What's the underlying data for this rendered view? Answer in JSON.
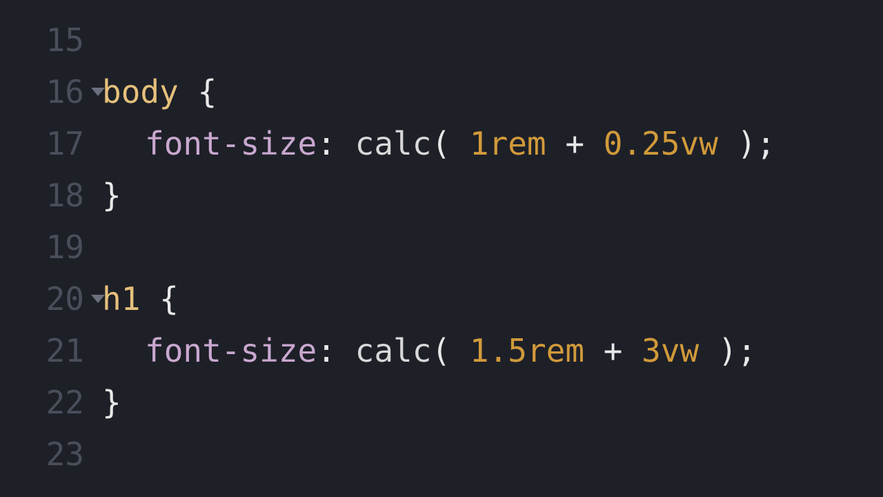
{
  "colors": {
    "background": "#1e2028",
    "line_number": "#4a4e5a",
    "selector": "#e6c07b",
    "property": "#c9a8cf",
    "number": "#d19a3a",
    "punctuation": "#e8e8e8",
    "fold_arrow": "#6b6f7d"
  },
  "lines": {
    "l15": {
      "num": "15"
    },
    "l16": {
      "num": "16",
      "selector": "body",
      "brace": "{",
      "foldable": true
    },
    "l17": {
      "num": "17",
      "property": "font-size",
      "colon": ":",
      "func": "calc",
      "lparen": "(",
      "val1_num": "1",
      "val1_unit": "rem",
      "op": "+",
      "val2_num": "0.25",
      "val2_unit": "vw",
      "rparen": ")",
      "semi": ";"
    },
    "l18": {
      "num": "18",
      "brace": "}"
    },
    "l19": {
      "num": "19"
    },
    "l20": {
      "num": "20",
      "selector": "h1",
      "brace": "{",
      "foldable": true
    },
    "l21": {
      "num": "21",
      "property": "font-size",
      "colon": ":",
      "func": "calc",
      "lparen": "(",
      "val1_num": "1.5",
      "val1_unit": "rem",
      "op": "+",
      "val2_num": "3",
      "val2_unit": "vw",
      "rparen": ")",
      "semi": ";"
    },
    "l22": {
      "num": "22",
      "brace": "}"
    },
    "l23": {
      "num": "23"
    }
  }
}
